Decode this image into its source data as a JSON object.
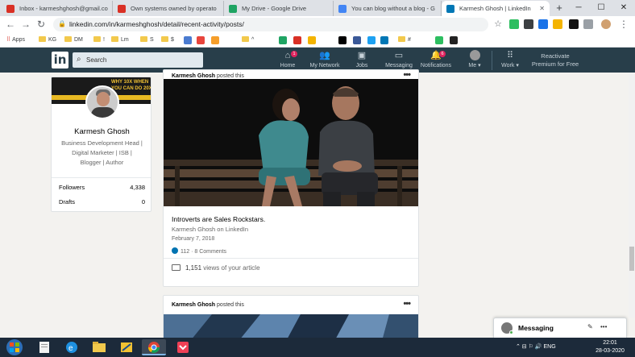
{
  "browser": {
    "tabs": [
      {
        "title": "Inbox - karmeshghosh@gmail.co",
        "favicon_color": "#d93025",
        "favicon_icon": "gmail-icon",
        "active": false
      },
      {
        "title": "Own systems owned by operato",
        "favicon_color": "#d93025",
        "favicon_icon": "gmail-icon",
        "active": false
      },
      {
        "title": "My Drive - Google Drive",
        "favicon_color": "#1fa463",
        "favicon_icon": "drive-icon",
        "active": false
      },
      {
        "title": "You can blog without a blog - G",
        "favicon_color": "#4285f4",
        "favicon_icon": "docs-icon",
        "active": false
      },
      {
        "title": "Karmesh Ghosh | LinkedIn",
        "favicon_color": "#0077b5",
        "favicon_icon": "linkedin-icon",
        "active": true
      }
    ],
    "new_tab": "+",
    "url": "linkedin.com/in/karmeshghosh/detail/recent-activity/posts/",
    "bookmarks": [
      {
        "label": "Apps",
        "type": "apps"
      },
      {
        "label": "KG",
        "type": "folder"
      },
      {
        "label": "DM",
        "type": "folder"
      },
      {
        "label": "!",
        "type": "folder"
      },
      {
        "label": "Lm",
        "type": "folder"
      },
      {
        "label": "S",
        "type": "folder"
      },
      {
        "label": "$",
        "type": "folder"
      },
      {
        "label": "^",
        "type": "folder"
      },
      {
        "label": "#",
        "type": "folder"
      }
    ]
  },
  "linkedin": {
    "logo": "in",
    "search_placeholder": "Search",
    "nav": [
      {
        "label": "Home",
        "icon": "home-icon",
        "badge": "1"
      },
      {
        "label": "My Network",
        "icon": "network-icon",
        "badge": ""
      },
      {
        "label": "Jobs",
        "icon": "briefcase-icon",
        "badge": ""
      },
      {
        "label": "Messaging",
        "icon": "message-icon",
        "badge": ""
      },
      {
        "label": "Notifications",
        "icon": "bell-icon",
        "badge": "6"
      }
    ],
    "me_label": "Me",
    "work_label": "Work",
    "premium_line1": "Reactivate",
    "premium_line2": "Premium for Free"
  },
  "profile": {
    "banner_text": "WHY 10X WHEN YOU CAN DO 20X",
    "name": "Karmesh Ghosh",
    "headline": "Business Development Head | Digital Marketer | ISB | Blogger | Author",
    "stats": [
      {
        "label": "Followers",
        "value": "4,338"
      },
      {
        "label": "Drafts",
        "value": "0"
      }
    ]
  },
  "posts": [
    {
      "actor": "Karmesh Ghosh",
      "action": "posted this",
      "menu": "•••",
      "title": "Introverts are Sales Rockstars.",
      "source": "Karmesh Ghosh on LinkedIn",
      "date": "February 7, 2018",
      "reactions": "112 · 8 Comments",
      "views_count": "1,151",
      "views_suffix": "views of your article"
    },
    {
      "actor": "Karmesh Ghosh",
      "action": "posted this",
      "menu": "•••"
    }
  ],
  "messaging_widget": {
    "label": "Messaging"
  },
  "taskbar": {
    "tray_icons": "⌃  ⊟  ⚐  🔊  ENG",
    "time": "22:01",
    "date": "28-03-2020"
  }
}
